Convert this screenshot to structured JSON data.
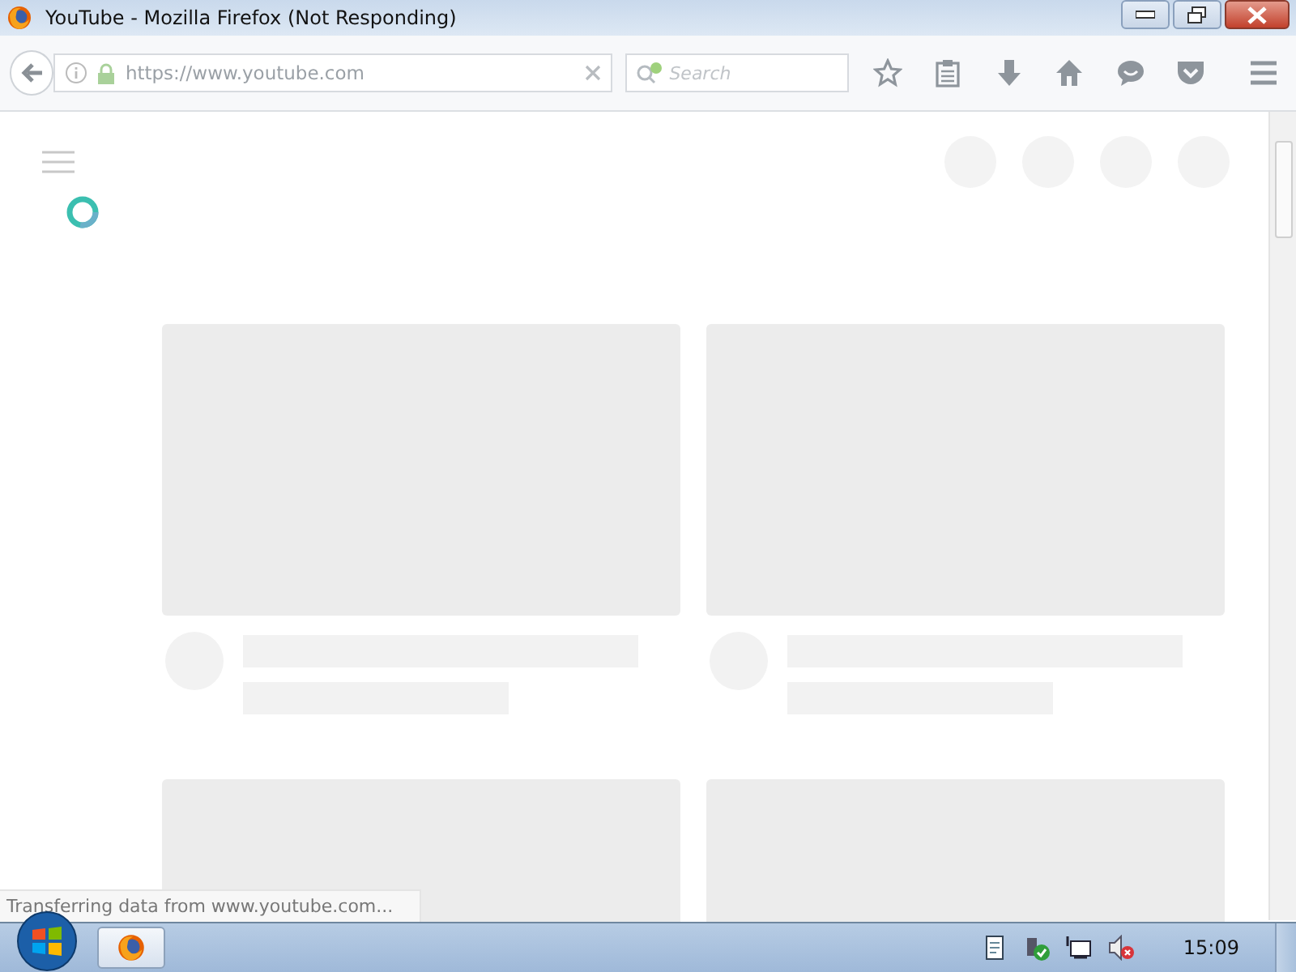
{
  "window": {
    "title": "YouTube - Mozilla Firefox (Not Responding)"
  },
  "toolbar": {
    "url": "https://www.youtube.com",
    "search": {
      "placeholder": "Search"
    }
  },
  "status_bar": {
    "text": "Transferring data from www.youtube.com..."
  },
  "taskbar": {
    "clock": "15:09"
  }
}
